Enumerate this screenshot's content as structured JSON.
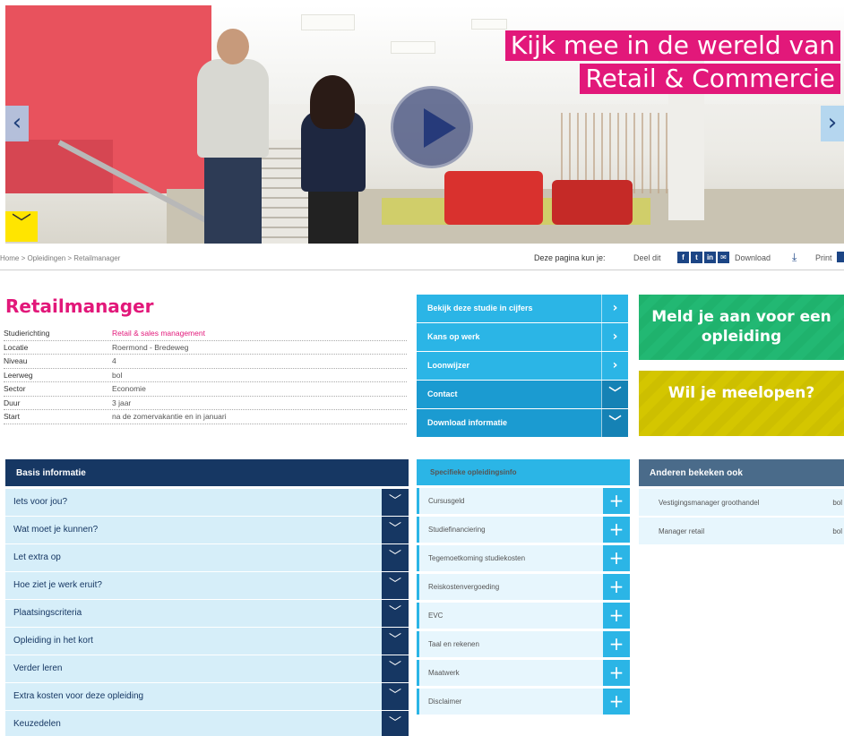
{
  "hero": {
    "title_line1": "Kijk mee in de wereld van",
    "title_line2": "Retail & Commercie",
    "prev_arrow": "‹",
    "next_arrow": "›",
    "expand_arrow": "﹀"
  },
  "breadcrumb": "Home > Opleidingen > Retailmanager",
  "share": {
    "label": "Deze pagina kun je:",
    "deel_label": "Deel dit",
    "download_label": "Download",
    "print_label": "Print"
  },
  "course": {
    "title": "Retailmanager",
    "facts": [
      {
        "key": "Studierichting",
        "value": "Retail & sales management"
      },
      {
        "key": "Locatie",
        "value": "Roermond - Bredeweg"
      },
      {
        "key": "Niveau",
        "value": "4"
      },
      {
        "key": "Leerweg",
        "value": "bol"
      },
      {
        "key": "Sector",
        "value": "Economie"
      },
      {
        "key": "Duur",
        "value": "3 jaar"
      },
      {
        "key": "Start",
        "value": "na de zomervakantie en in januari"
      }
    ]
  },
  "mid_buttons": [
    {
      "label": "Bekijk deze studie in cijfers",
      "icon": "›"
    },
    {
      "label": "Kans op werk",
      "icon": "›"
    },
    {
      "label": "Loonwijzer",
      "icon": "›"
    },
    {
      "label": "Contact",
      "icon": "﹀"
    },
    {
      "label": "Download informatie",
      "icon": "﹀"
    }
  ],
  "cta": {
    "meld_aan": "Meld je aan voor een opleiding",
    "meelopen": "Wil je meelopen?"
  },
  "basis": {
    "title": "Basis informatie",
    "items": [
      "Iets voor jou?",
      "Wat moet je kunnen?",
      "Let extra op",
      "Hoe ziet je werk eruit?",
      "Plaatsingscriteria",
      "Opleiding in het kort",
      "Verder leren",
      "Extra kosten voor deze opleiding",
      "Keuzedelen"
    ],
    "toggle_icon": "﹀"
  },
  "specifiek": {
    "title": "Specifieke opleidingsinfo",
    "items": [
      "Cursusgeld",
      "Studiefinanciering",
      "Tegemoetkoming studiekosten",
      "Reiskostenvergoeding",
      "EVC",
      "Taal en rekenen",
      "Maatwerk",
      "Disclaimer"
    ],
    "plus_icon": "+"
  },
  "anderen": {
    "title": "Anderen bekeken ook",
    "items": [
      {
        "label": "Vestigingsmanager groothandel",
        "leerweg": "bol"
      },
      {
        "label": "Manager retail",
        "leerweg": "bol"
      }
    ]
  },
  "colors": {
    "pink": "#e2187a",
    "navy": "#163763",
    "cyan": "#2bb5e6",
    "green": "#1fb26d",
    "yellow": "#cdbf00"
  }
}
